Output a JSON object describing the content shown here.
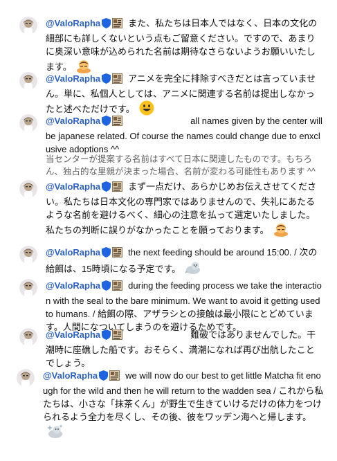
{
  "messages": [
    {
      "author": "@ValoRapha",
      "text": "また、私たちは日本人ではなく、日本の文化の細部にも詳しくないという点もご留意ください。ですので、あまりに奥深い意味が込められた名前は期待なさらないようお願いいたします。",
      "emoji": "person-bowing-emoji"
    },
    {
      "author": "@ValoRapha",
      "text": "アニメを完全に排除すべきだとは言っていません。単に、私個人としては、アニメに関連する名前は提出しなかったと述べただけです。",
      "emoji": "grinning-face-emoji"
    },
    {
      "author": "@ValoRapha",
      "text": "all names given by the center will be japanese related. Of course the names could change due to enxclusive adoptions ^^",
      "translation": "当センターが提案する名前はすべて日本に関連したものです。もちろん、独占的な里親が決まった場合、名前が変わる可能性もあります ^^"
    },
    {
      "author": "@ValoRapha",
      "text": "まず一点だけ、あらかじめお伝えさせてください。私たちは日本文化の専門家ではありませんので、失礼にあたるような名前を避けるべく、細心の注意を払って選定いたしました。私たちの判断に誤りがなかったことを願っております。",
      "emoji": "person-bowing-emoji"
    },
    {
      "author": "@ValoRapha",
      "text": "the next feeding should be around 15:00. / 次の給餌は、15時頃になる予定です。",
      "emoji": "seal-emoji"
    },
    {
      "author": "@ValoRapha",
      "text": "during the feeding process we take the interaction with the seal to the bare minimum. We want to avoid it getting used to humans. / 給餌の際、アザラシとの接触は最小限にとどめています。人間になついてしまうのを避けるためです。"
    },
    {
      "author": "@ValoRapha",
      "text": "難破ではありませんでした。干潮時に座礁した船です。おそらく、満潮になれば再び出航したことでしょう。"
    },
    {
      "author": "@ValoRapha",
      "text": "we will now do our best to get little Matcha fit enough for the wild and then he will return to the wadden sea / これから私たちは、小さな「抹茶くん」が野生で生きていけるだけの体力をつけられるよう全力を尽くし、その後、彼をワッデン海へと帰します。",
      "emoji": "seal-sparkle-emoji"
    }
  ],
  "colors": {
    "author": "#2a5fc4",
    "text": "#0f0f0f",
    "badge": "#1e63e0",
    "translation": "#606060"
  }
}
